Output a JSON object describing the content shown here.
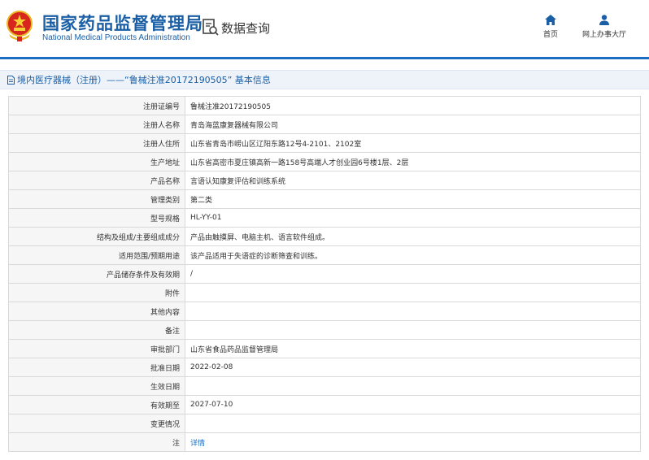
{
  "header": {
    "brand_cn": "国家药品监督管理局",
    "brand_en": "National Medical Products Administration",
    "emblem_icon": "national-emblem-icon",
    "data_query_label": "数据查询",
    "nav": [
      {
        "label": "首页",
        "icon": "home-icon"
      },
      {
        "label": "网上办事大厅",
        "icon": "user-icon"
      }
    ],
    "accent_color": "#1a6fc4",
    "brand_color": "#1a5fa6"
  },
  "breadcrumb": {
    "text": "境内医疗器械（注册）——“鲁械注准20172190505” 基本信息",
    "icon": "document-icon"
  },
  "record": {
    "rows": [
      {
        "label": "注册证编号",
        "value": "鲁械注准20172190505"
      },
      {
        "label": "注册人名称",
        "value": "青岛海蓝康复器械有限公司"
      },
      {
        "label": "注册人住所",
        "value": "山东省青岛市崂山区辽阳东路12号4-2101、2102室"
      },
      {
        "label": "生产地址",
        "value": "山东省高密市夏庄镇高新一路158号高端人才创业园6号楼1层、2层"
      },
      {
        "label": "产品名称",
        "value": "言语认知康复评估和训练系统"
      },
      {
        "label": "管理类别",
        "value": "第二类"
      },
      {
        "label": "型号规格",
        "value": "HL-YY-01"
      },
      {
        "label": "结构及组成/主要组成成分",
        "value": "产品由触摸屏、电脑主机、语言软件组成。"
      },
      {
        "label": "适用范围/预期用途",
        "value": "该产品适用于失语症的诊断筛查和训练。"
      },
      {
        "label": "产品储存条件及有效期",
        "value": "/"
      },
      {
        "label": "附件",
        "value": ""
      },
      {
        "label": "其他内容",
        "value": ""
      },
      {
        "label": "备注",
        "value": ""
      },
      {
        "label": "审批部门",
        "value": "山东省食品药品监督管理局"
      },
      {
        "label": "批准日期",
        "value": "2022-02-08"
      },
      {
        "label": "生效日期",
        "value": ""
      },
      {
        "label": "有效期至",
        "value": "2027-07-10"
      },
      {
        "label": "变更情况",
        "value": ""
      }
    ],
    "note_row": {
      "label": "注",
      "link_text": "详情"
    }
  }
}
